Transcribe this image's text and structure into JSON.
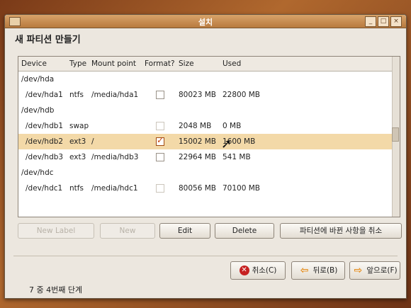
{
  "window": {
    "title": "설치",
    "controls": [
      "_",
      "□",
      "×"
    ]
  },
  "heading": "새 파티션 만들기",
  "table": {
    "headers": [
      "Device",
      "Type",
      "Mount point",
      "Format?",
      "Size",
      "Used"
    ],
    "rows": [
      {
        "device": "/dev/hda",
        "type": "",
        "mount": "",
        "format": null,
        "size": "",
        "used": "",
        "indent": false
      },
      {
        "device": "/dev/hda1",
        "type": "ntfs",
        "mount": "/media/hda1",
        "format": "unchecked",
        "size": "80023 MB",
        "used": "22800 MB",
        "indent": true
      },
      {
        "device": "/dev/hdb",
        "type": "",
        "mount": "",
        "format": null,
        "size": "",
        "used": "",
        "indent": false
      },
      {
        "device": "/dev/hdb1",
        "type": "swap",
        "mount": "",
        "format": "disabled",
        "size": "2048 MB",
        "used": "0 MB",
        "indent": true
      },
      {
        "device": "/dev/hdb2",
        "type": "ext3",
        "mount": "/",
        "format": "checked",
        "size": "15002 MB",
        "used": "1600 MB",
        "indent": true,
        "selected": true
      },
      {
        "device": "/dev/hdb3",
        "type": "ext3",
        "mount": "/media/hdb3",
        "format": "unchecked",
        "size": "22964 MB",
        "used": "541 MB",
        "indent": true
      },
      {
        "device": "/dev/hdc",
        "type": "",
        "mount": "",
        "format": null,
        "size": "",
        "used": "",
        "indent": false
      },
      {
        "device": "/dev/hdc1",
        "type": "ntfs",
        "mount": "/media/hdc1",
        "format": "disabled",
        "size": "80056 MB",
        "used": "70100 MB",
        "indent": true
      }
    ]
  },
  "actions": {
    "new_label": "New Label",
    "new": "New",
    "edit": "Edit",
    "delete": "Delete",
    "undo": "파티션에 바뀐 사항을 취소"
  },
  "footer": {
    "step": "7 중 4번째 단계",
    "cancel": "취소(C)",
    "back": "뒤로(B)",
    "forward": "앞으로(F)"
  },
  "colors": {
    "selected_row": "#f3d9a8",
    "title_bar": "#c8894a",
    "check": "#c6420a"
  }
}
